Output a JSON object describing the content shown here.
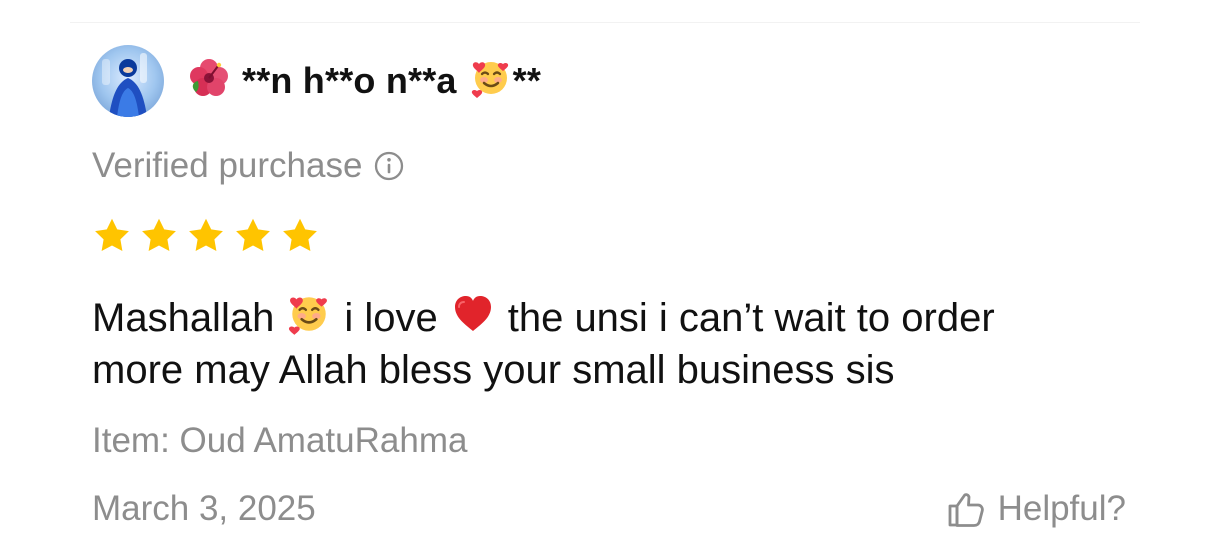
{
  "review": {
    "username": "**n h**o n**a",
    "username_suffix": "**",
    "verified_label": "Verified purchase",
    "rating": 5,
    "max_rating": 5,
    "text_line1_part1": "Mashallah",
    "text_line1_part2": "i love",
    "text_line1_part3": "the unsi i can’t wait to order",
    "text_line2": "more may Allah bless your small business sis",
    "item_text": "Item: Oud AmatuRahma",
    "date": "March 3, 2025",
    "helpful_label": "Helpful?"
  },
  "colors": {
    "star": "#FFC400",
    "secondary_text": "#8D8D8D",
    "primary_text": "#111111",
    "heart": "#E1242B"
  },
  "icons": {
    "avatar": "avatar",
    "hibiscus": "hibiscus-icon",
    "smiling_face_hearts": "smiling-face-with-hearts-icon",
    "info": "info-icon",
    "star": "star-icon",
    "heart": "red-heart-icon",
    "thumb_up": "thumb-up-icon"
  }
}
